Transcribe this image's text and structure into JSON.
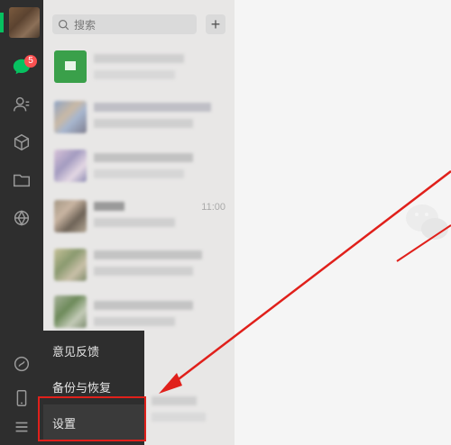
{
  "sidebar": {
    "unread_count": "5",
    "icons": [
      "chat-icon",
      "contacts-icon",
      "favorites-icon",
      "files-icon",
      "moments-icon",
      "mini-program-icon",
      "phone-icon",
      "menu-icon"
    ]
  },
  "search": {
    "placeholder": "搜索",
    "add_label": "+"
  },
  "chat_list": {
    "items": [
      {
        "time": ""
      },
      {
        "time": ""
      },
      {
        "time": ""
      },
      {
        "time": "11:00"
      },
      {
        "time": ""
      },
      {
        "time": ""
      }
    ]
  },
  "menu": {
    "items": [
      {
        "label": "意见反馈"
      },
      {
        "label": "备份与恢复"
      },
      {
        "label": "设置"
      }
    ]
  },
  "colors": {
    "accent": "#07c160",
    "badge": "#fa5151",
    "annotation": "#e0201b",
    "sidebar": "#2e2e2e"
  }
}
